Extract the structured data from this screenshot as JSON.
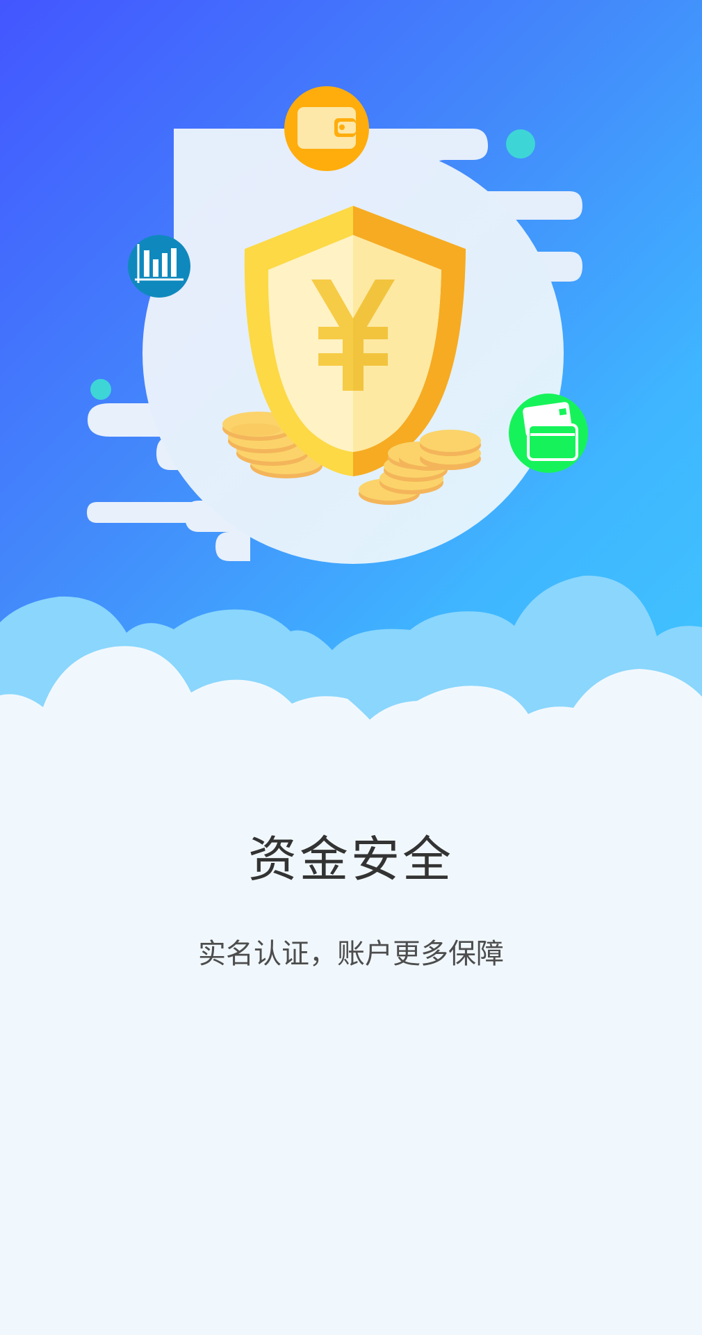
{
  "onboarding": {
    "title": "资金安全",
    "subtitle": "实名认证，账户更多保障"
  },
  "icons": {
    "hero": "shield-yen-icon",
    "top": "wallet-icon",
    "left": "bar-chart-icon",
    "right": "bank-card-icon",
    "coins": "coin-stack-icon"
  },
  "colors": {
    "gradient_start": "#4356ff",
    "gradient_end": "#40c7fd",
    "shield_light": "#fcd945",
    "shield_dark": "#f6ab23",
    "wallet_badge": "#ffad0c",
    "chart_badge": "#0f89bd",
    "card_badge": "#16f35a",
    "dot_accent": "#3ed5d6",
    "text_title": "#333333",
    "text_subtitle": "#4d4d4d"
  }
}
